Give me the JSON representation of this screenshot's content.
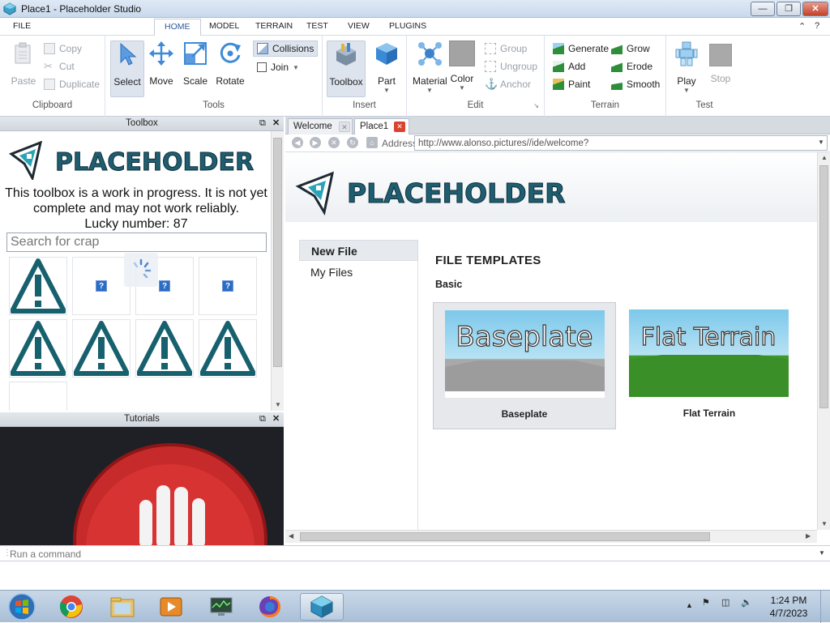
{
  "window": {
    "title": "Place1 - Placeholder Studio"
  },
  "menu": {
    "file": "FILE",
    "tabs": [
      "HOME",
      "MODEL",
      "TERRAIN",
      "TEST",
      "VIEW",
      "PLUGINS"
    ],
    "active_tab": "HOME"
  },
  "ribbon": {
    "clipboard": {
      "label": "Clipboard",
      "paste": "Paste",
      "copy": "Copy",
      "cut": "Cut",
      "duplicate": "Duplicate"
    },
    "tools": {
      "label": "Tools",
      "select": "Select",
      "move": "Move",
      "scale": "Scale",
      "rotate": "Rotate",
      "collisions": "Collisions",
      "join": "Join"
    },
    "insert": {
      "label": "Insert",
      "toolbox": "Toolbox",
      "part": "Part"
    },
    "edit": {
      "label": "Edit",
      "material": "Material",
      "color": "Color",
      "group": "Group",
      "ungroup": "Ungroup",
      "anchor": "Anchor"
    },
    "terrain": {
      "label": "Terrain",
      "generate": "Generate",
      "add": "Add",
      "paint": "Paint",
      "grow": "Grow",
      "erode": "Erode",
      "smooth": "Smooth"
    },
    "test": {
      "label": "Test",
      "play": "Play",
      "stop": "Stop"
    }
  },
  "toolbox": {
    "header": "Toolbox",
    "logo_text": "PLACEHOLDER",
    "notice": "This toolbox is a work in progress. It is not yet complete and may not work reliably.",
    "lucky": "Lucky number: 87",
    "search_placeholder": "Search for crap"
  },
  "tutorials": {
    "header": "Tutorials"
  },
  "doc_tabs": [
    {
      "label": "Welcome"
    },
    {
      "label": "Place1"
    }
  ],
  "address": {
    "label": "Address",
    "url": "http://www.alonso.pictures//ide/welcome?"
  },
  "welcome": {
    "logo_text": "PLACEHOLDER",
    "nav": [
      "New File",
      "My Files"
    ],
    "section_title": "FILE TEMPLATES",
    "subsection": "Basic",
    "templates": [
      {
        "name": "Baseplate",
        "thumb_text": "Baseplate"
      },
      {
        "name": "Flat Terrain",
        "thumb_text": "Flat Terrain"
      }
    ]
  },
  "command_bar": {
    "placeholder": "Run a command"
  },
  "taskbar": {
    "time": "1:24 PM",
    "date": "4/7/2023"
  },
  "colors": {
    "accent": "#2b5a9e",
    "logo_teal": "#1f5e70",
    "close_red": "#d9432f"
  }
}
